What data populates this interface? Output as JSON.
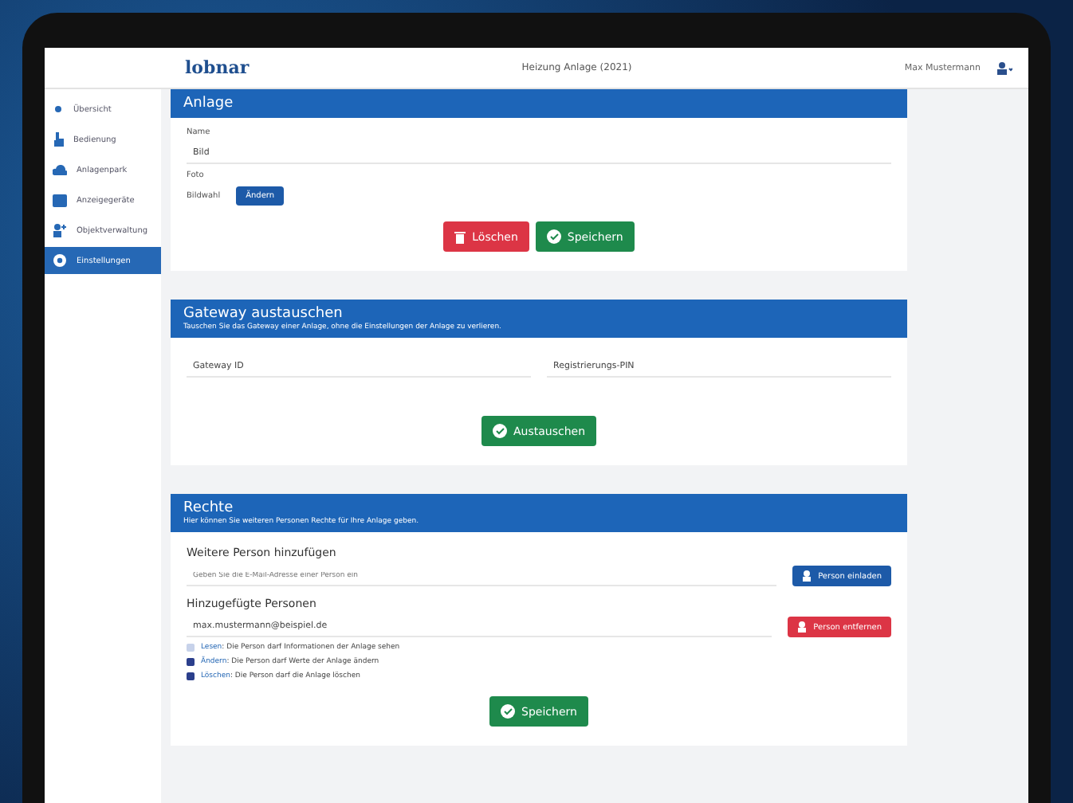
{
  "header": {
    "brand": "lobnar",
    "title": "Heizung Anlage (2021)",
    "user": "Max Mustermann"
  },
  "sidebar": {
    "items": [
      {
        "label": "Übersicht",
        "selected": false
      },
      {
        "label": "Bedienung",
        "selected": false
      },
      {
        "label": "Anlagenpark",
        "selected": false
      },
      {
        "label": "Anzeigegeräte",
        "selected": false
      },
      {
        "label": "Objektverwaltung",
        "selected": false
      },
      {
        "label": "Einstellungen",
        "selected": true
      }
    ]
  },
  "anlage": {
    "title": "Anlage",
    "name_label": "Name",
    "name_value": "Bild",
    "foto_label": "Foto",
    "file_label": "Bildwahl",
    "file_button": "Ändern",
    "delete_button": "Löschen",
    "save_button": "Speichern"
  },
  "gateway": {
    "title": "Gateway austauschen",
    "subtitle": "Tauschen Sie das Gateway einer Anlage, ohne die Einstellungen der Anlage zu verlieren.",
    "id_label": "Gateway ID",
    "pin_label": "Registrierungs-PIN",
    "button": "Austauschen"
  },
  "rechte": {
    "title": "Rechte",
    "subtitle": "Hier können Sie weiteren Personen Rechte für Ihre Anlage geben.",
    "add_heading": "Weitere Person hinzufügen",
    "add_placeholder": "Geben Sie die E-Mail-Adresse einer Person ein",
    "add_button": "Person einladen",
    "list_heading": "Hinzugefügte Personen",
    "person": "max.mustermann@beispiel.de",
    "remove_button": "Person entfernen",
    "permissions": [
      {
        "action": "Lesen",
        "desc": ": Die Person darf Informationen der Anlage sehen",
        "checked": false
      },
      {
        "action": "Ändern",
        "desc": ": Die Person darf Werte der Anlage ändern",
        "checked": true
      },
      {
        "action": "Löschen",
        "desc": ": Die Person darf die Anlage löschen",
        "checked": true
      }
    ],
    "save_button": "Speichern"
  }
}
